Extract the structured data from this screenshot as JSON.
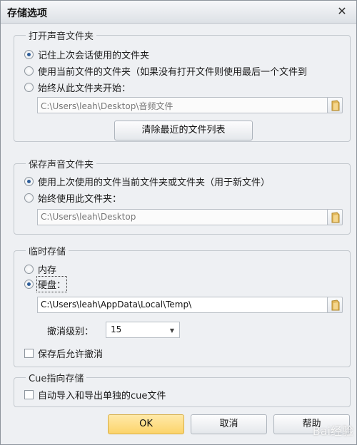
{
  "dialog": {
    "title": "存储选项"
  },
  "open_sound": {
    "title": "打开声音文件夹",
    "opt_last_session": "记住上次会话使用的文件夹",
    "opt_current_file": "使用当前文件的文件夹（如果没有打开文件则使用最后一个文件到",
    "opt_always_from": "始终从此文件夹开始：",
    "path": "C:\\Users\\leah\\Desktop\\音频文件",
    "clear_recent": "清除最近的文件列表"
  },
  "save_sound": {
    "title": "保存声音文件夹",
    "opt_last_used": "使用上次使用的文件当前文件夹或文件夹（用于新文件）",
    "opt_always_use": "始终使用此文件夹：",
    "path": "C:\\Users\\leah\\Desktop"
  },
  "temp_storage": {
    "title": "临时存储",
    "opt_memory": "内存",
    "opt_disk": "硬盘：",
    "path": "C:\\Users\\leah\\AppData\\Local\\Temp\\",
    "undo_label": "撤消级别：",
    "undo_value": "15",
    "allow_undo_after_save": "保存后允许撤消"
  },
  "cue_storage": {
    "title": "Cue指向存储",
    "auto_import_export": "自动导入和导出单独的cue文件"
  },
  "buttons": {
    "ok": "OK",
    "cancel": "取消",
    "help": "帮助"
  },
  "watermark": "Bai经验",
  "icons": [
    "close-icon",
    "folder-icon",
    "chevron-down-icon"
  ]
}
